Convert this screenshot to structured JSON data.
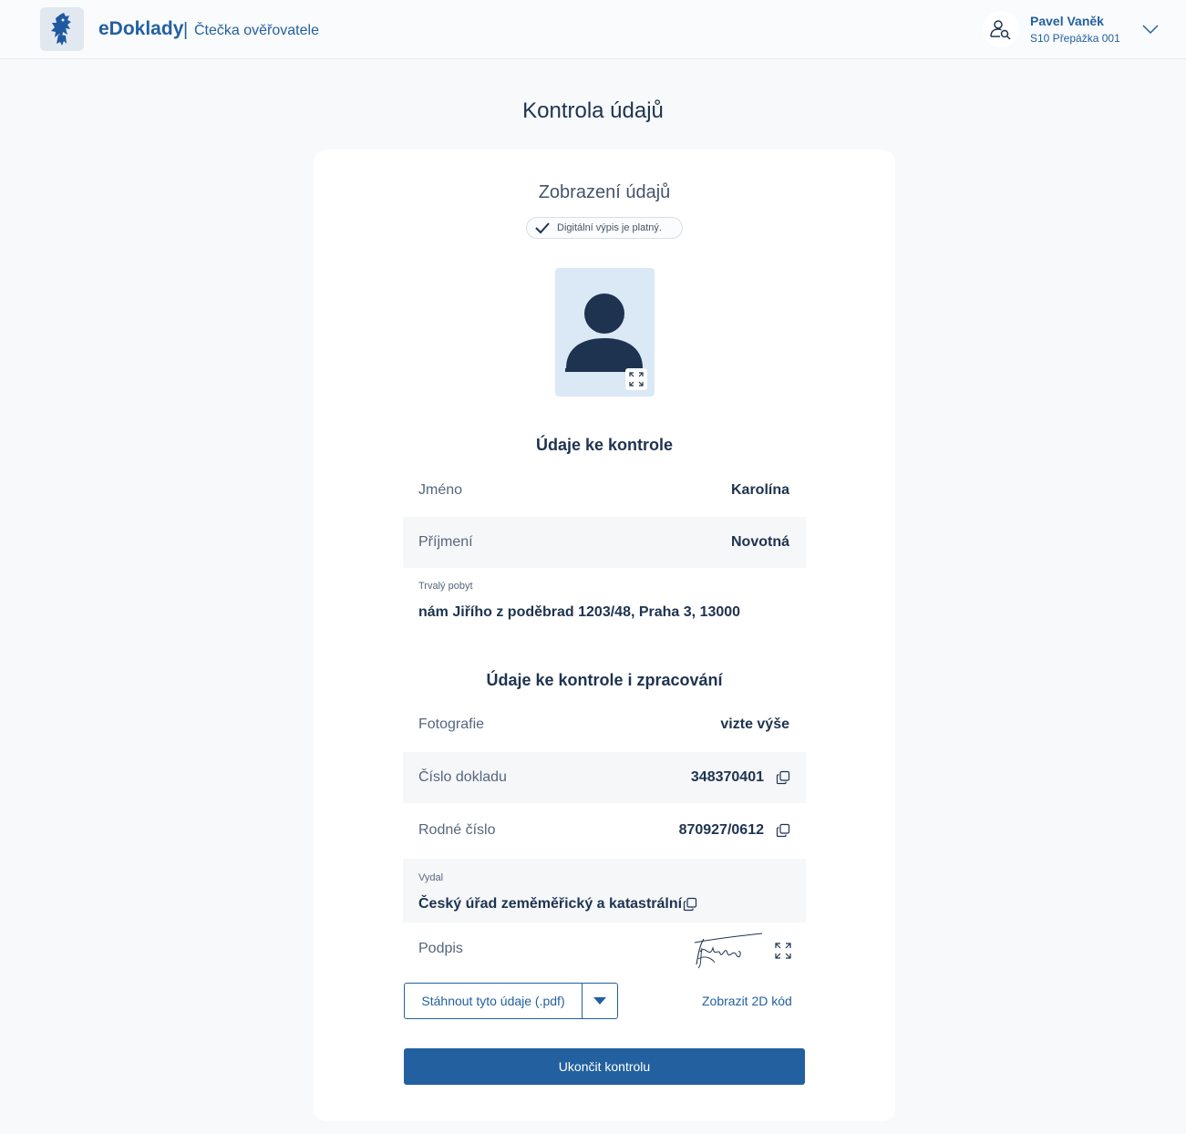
{
  "header": {
    "brand": "eDoklady",
    "separator": "|",
    "subtitle": "Čtečka ověřovatele",
    "user_name": "Pavel Vaněk",
    "user_station": "S10 Přepážka 001",
    "icons": [
      "coat-of-arms-logo",
      "user-search-icon",
      "chevron-down-icon"
    ]
  },
  "page": {
    "title": "Kontrola údajů"
  },
  "card": {
    "heading": "Zobrazení údajů",
    "validity_badge": "Digitální výpis je platný.",
    "photo_icons": [
      "person-placeholder-icon",
      "expand-icon"
    ]
  },
  "section_check": {
    "title": "Údaje ke kontrole",
    "rows": [
      {
        "label": "Jméno",
        "value": "Karolína"
      },
      {
        "label": "Příjmení",
        "value": "Novotná"
      }
    ],
    "address_label": "Trvalý pobyt",
    "address_value": "nám Jiřího z poděbrad 1203/48, Praha 3, 13000"
  },
  "section_process": {
    "title": "Údaje ke kontrole i zpracování",
    "rows": [
      {
        "label": "Fotografie",
        "value": "vizte výše"
      },
      {
        "label": "Číslo dokladu",
        "value": "348370401"
      },
      {
        "label": "Rodné číslo",
        "value": "870927/0612"
      }
    ],
    "issuer_label": "Vydal",
    "issuer_value": "Český úřad zeměměřický a katastrální",
    "signature_label": "Podpis"
  },
  "actions": {
    "download_label": "Stáhnout tyto údaje (.pdf)",
    "show_2d_label": "Zobrazit 2D kód",
    "finish_label": "Ukončit kontrolu"
  },
  "colors": {
    "primary": "#23609f",
    "text_dark": "#1e3350",
    "photo_bg": "#dbe8f5",
    "page_bg": "#f8f9fa"
  }
}
